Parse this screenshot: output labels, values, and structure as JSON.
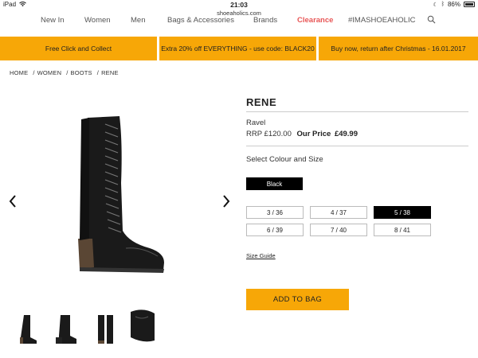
{
  "status_bar": {
    "device": "iPad",
    "time": "21:03",
    "battery": "86%",
    "url": "shoeaholics.com"
  },
  "nav": {
    "items": [
      "New In",
      "Women",
      "Men",
      "Bags & Accessories",
      "Brands",
      "Clearance",
      "#IMASHOEAHOLIC"
    ]
  },
  "promos": [
    "Free Click and Collect",
    "Extra 20% off EVERYTHING - use code: BLACK20",
    "Buy now, return after Christmas - 16.01.2017"
  ],
  "breadcrumb": [
    "HOME",
    "WOMEN",
    "BOOTS",
    "RENE"
  ],
  "breadcrumb_sep": "/",
  "product": {
    "title": "RENE",
    "brand": "Ravel",
    "rrp_label": "RRP",
    "rrp_value": "£120.00",
    "our_price_label": "Our Price",
    "our_price": "£49.99",
    "select_label": "Select Colour and Size",
    "colour": "Black",
    "sizes": [
      "3 / 36",
      "4 / 37",
      "5 / 38",
      "6 / 39",
      "7 / 40",
      "8 / 41"
    ],
    "selected_size": "5 / 38",
    "size_guide": "Size Guide",
    "add_to_bag": "ADD TO BAG"
  },
  "colors": {
    "accent": "#f7a707",
    "clearance": "#e85656",
    "selected": "#000000"
  },
  "icons": {
    "prev": "chevron-left-icon",
    "next": "chevron-right-icon",
    "search": "search-icon"
  }
}
